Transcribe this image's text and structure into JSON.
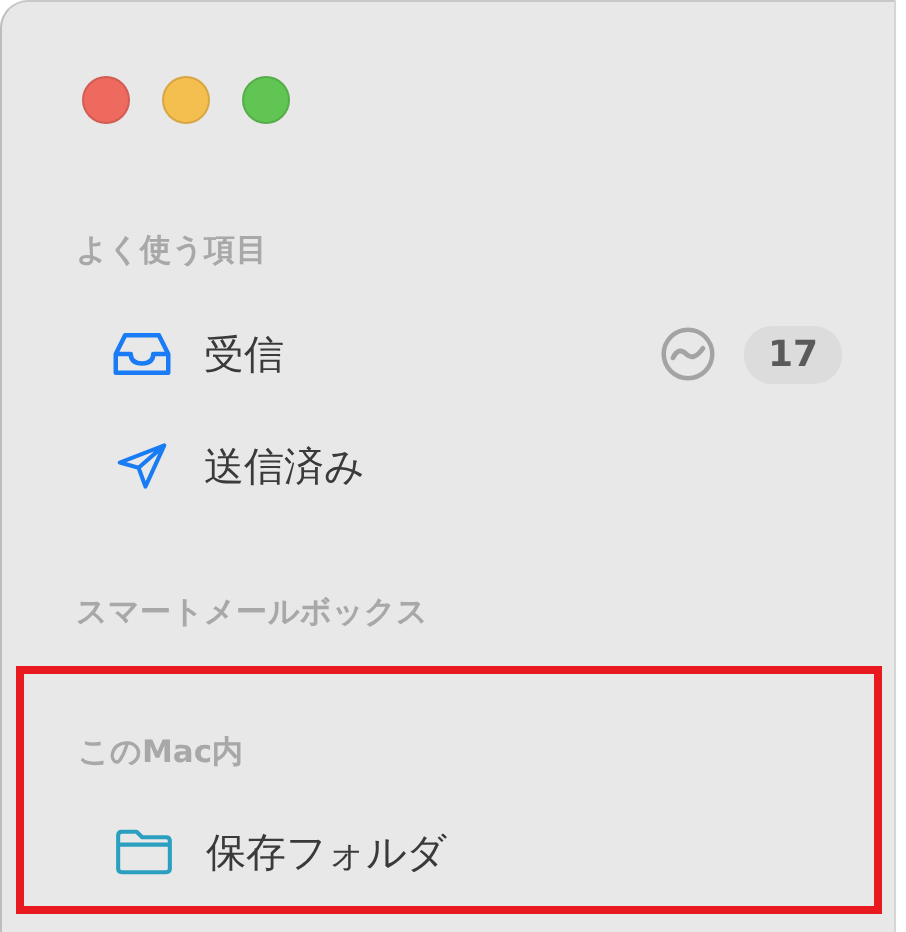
{
  "window": {
    "buttons": [
      {
        "color": "#ee6a5f"
      },
      {
        "color": "#f5bf4f"
      },
      {
        "color": "#61c554"
      }
    ]
  },
  "sections": [
    {
      "title": "よく使う項目",
      "highlighted": false,
      "items": [
        {
          "label": "受信",
          "kind": "inbox",
          "activity": true,
          "badge": "17"
        },
        {
          "label": "送信済み",
          "kind": "sent",
          "activity": false
        }
      ]
    },
    {
      "title": "スマートメールボックス",
      "highlighted": false
    },
    {
      "title": "このMac内",
      "highlighted": true,
      "items": [
        {
          "label": "保存フォルダ",
          "kind": "folder",
          "activity": false
        }
      ]
    }
  ]
}
